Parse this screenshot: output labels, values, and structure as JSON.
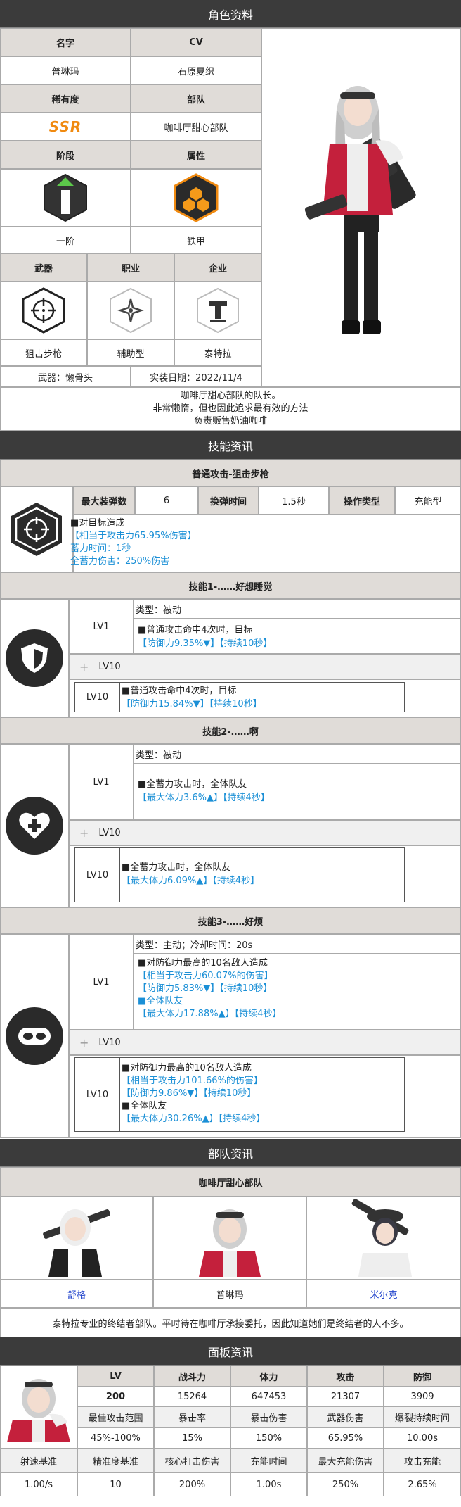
{
  "section_titles": {
    "profile": "角色资料",
    "skills": "技能资讯",
    "squad": "部队资讯",
    "stats": "面板资讯"
  },
  "profile": {
    "name_label": "名字",
    "cv_label": "CV",
    "name": "普琳玛",
    "cv": "石原夏织",
    "rarity_label": "稀有度",
    "squad_label": "部队",
    "rarity": "SSR",
    "squad": "咖啡厅甜心部队",
    "stage_label": "阶段",
    "attr_label": "属性",
    "stage": "一阶",
    "attr": "铁甲",
    "weapon_label": "武器",
    "class_label": "职业",
    "company_label": "企业",
    "weapon": "狙击步枪",
    "class": "辅助型",
    "company": "泰特拉",
    "weapon_name": "武器：懒骨头",
    "release": "实装日期：2022/11/4",
    "desc": [
      "咖啡厅甜心部队的队长。",
      "非常懒惰，但也因此追求最有效的方法",
      "负责贩售奶油咖啡"
    ]
  },
  "normal_attack": {
    "title": "普通攻击-狙击步枪",
    "ammo_label": "最大装弹数",
    "ammo": "6",
    "reload_label": "换弹时间",
    "reload": "1.5秒",
    "control_label": "操作类型",
    "control": "充能型",
    "lines": [
      "■对目标造成",
      "【相当于攻击力65.95%伤害】",
      "蓄力时间：1秒",
      "全蓄力伤害：250%伤害"
    ]
  },
  "skill1": {
    "title": "技能1-……好想睡觉",
    "lv1": "LV1",
    "lv10": "LV10",
    "type": "类型：被动",
    "lv1_lines": [
      "■普通攻击命中4次时，目标",
      "【防御力9.35%▼】【持续10秒】"
    ],
    "lv10_lines": [
      "■普通攻击命中4次时，目标",
      "【防御力15.84%▼】【持续10秒】"
    ]
  },
  "skill2": {
    "title": "技能2-……啊",
    "lv1": "LV1",
    "lv10": "LV10",
    "type": "类型：被动",
    "lv1_lines": [
      "■全蓄力攻击时，全体队友",
      "【最大体力3.6%▲】【持续4秒】"
    ],
    "lv10_lines": [
      "■全蓄力攻击时，全体队友",
      "【最大体力6.09%▲】【持续4秒】"
    ]
  },
  "skill3": {
    "title": "技能3-……好烦",
    "lv1": "LV1",
    "lv10": "LV10",
    "type": "类型：主动；冷却时间：20s",
    "lv1_lines": [
      "■对防御力最高的10名敌人造成",
      "【相当于攻击力60.07%的伤害】",
      "【防御力5.83%▼】【持续10秒】",
      "■全体队友",
      "【最大体力17.88%▲】【持续4秒】"
    ],
    "lv10_lines": [
      "■对防御力最高的10名敌人造成",
      "【相当于攻击力101.66%的伤害】",
      "【防御力9.86%▼】【持续10秒】",
      "■全体队友",
      "【最大体力30.26%▲】【持续4秒】"
    ]
  },
  "squad": {
    "name": "咖啡厅甜心部队",
    "members": [
      "舒格",
      "普琳玛",
      "米尔克"
    ],
    "desc": "泰特拉专业的终结者部队。平时待在咖啡厅承接委托，因此知道她们是终结者的人不多。"
  },
  "stats": {
    "row1_labels": [
      "LV",
      "战斗力",
      "体力",
      "攻击",
      "防御"
    ],
    "row1_values": [
      "200",
      "15264",
      "647453",
      "21307",
      "3909"
    ],
    "row2_labels": [
      "最佳攻击范围",
      "暴击率",
      "暴击伤害",
      "武器伤害",
      "爆裂持续时间"
    ],
    "row2_values": [
      "45%-100%",
      "15%",
      "150%",
      "65.95%",
      "10.00s"
    ],
    "row3_labels": [
      "射速基准",
      "精准度基准",
      "核心打击伤害",
      "充能时间",
      "最大充能伤害",
      "攻击充能"
    ],
    "row3_values": [
      "1.00/s",
      "10",
      "200%",
      "1.00s",
      "250%",
      "2.65%"
    ]
  },
  "colors": {
    "header_bg": "#3b3b3b",
    "label_bg": "#e0dcd8",
    "blue_text": "#1a8fd6",
    "jacket_red": "#c4203c"
  }
}
